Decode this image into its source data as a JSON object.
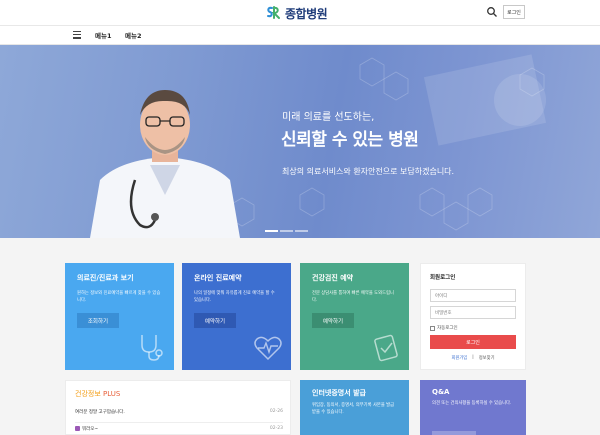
{
  "header": {
    "logo_text": "종합병원",
    "login_label": "로그인",
    "icons": {
      "search": "search-icon",
      "menu": "hamburger-menu-icon"
    }
  },
  "nav": {
    "items": [
      {
        "label": "메뉴1"
      },
      {
        "label": "메뉴2"
      }
    ]
  },
  "hero": {
    "line1": "미래 의료를 선도하는,",
    "line2": "신뢰할 수 있는 병원",
    "line3": "최상의 의료서비스와 환자안전으로 보답하겠습니다.",
    "slides": 3,
    "active_slide": 1
  },
  "cards": [
    {
      "title": "의료진/진료과 보기",
      "desc": "원하는 정보와 진료예약을 빠르게 찾을 수 있습니다.",
      "button": "조회하기",
      "color": "#4aa8f0",
      "btn_color": "#3a8fd6",
      "icon": "stethoscope-icon"
    },
    {
      "title": "온라인 진료예약",
      "desc": "나의 일정에 맞춰 자유롭게 진료 예약을 할 수 있습니다.",
      "button": "예약하기",
      "color": "#3d6fd0",
      "btn_color": "#2f59b3",
      "icon": "heartbeat-icon"
    },
    {
      "title": "건강검진 예약",
      "desc": "전문 상담사를 통하여 빠른 예약을 도와드립니다.",
      "button": "예약하기",
      "color": "#4aa889",
      "btn_color": "#3b8e72",
      "icon": "clipboard-check-icon"
    }
  ],
  "login": {
    "title": "회원로그인",
    "id_placeholder": "아이디",
    "pw_placeholder": "비밀번호",
    "auto_login": "자동로그인",
    "submit": "로그인",
    "join": "회원가입",
    "find": "정보찾기",
    "submit_color": "#e94b4b"
  },
  "health_news": {
    "title_main": "건강정보",
    "title_accent": "PLUS",
    "rows": [
      {
        "text": "여러분 정말 고구맙습니다.",
        "date": "02-26"
      },
      {
        "text": "뭐라오~",
        "date": "02-23"
      }
    ]
  },
  "certificate": {
    "title": "인터넷증명서 발급",
    "desc": "위임장, 동의서, 증명서, 의무기록 사본을 발급받을 수 있습니다."
  },
  "qa": {
    "title": "Q&A",
    "desc": "의견 또는 건의사항을 등록하실 수 있습니다."
  }
}
